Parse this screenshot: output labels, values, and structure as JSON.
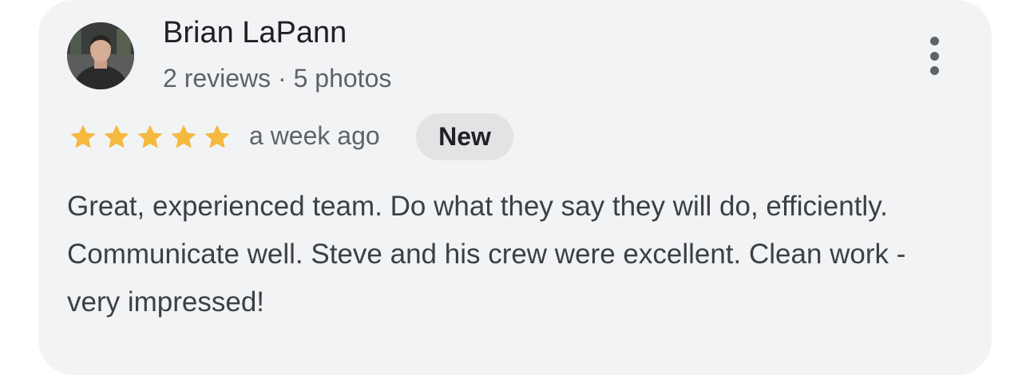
{
  "review": {
    "author": {
      "name": "Brian LaPann",
      "stats": "2 reviews · 5 photos",
      "avatar_icon": "user-photo-avatar"
    },
    "rating": 5,
    "max_rating": 5,
    "time_ago": "a week ago",
    "badge": "New",
    "text": "Great, experienced team. Do what they say they will do, efficiently. Communicate well. Steve and his crew were excellent. Clean work - very impressed!"
  },
  "icons": {
    "more_menu": "more-vert-icon",
    "star": "star-icon"
  },
  "colors": {
    "card_background": "#f2f3f5",
    "star_fill": "#f4b93e",
    "badge_background": "#e1e3e5",
    "primary_text": "#202124",
    "secondary_text": "#5f6368"
  }
}
